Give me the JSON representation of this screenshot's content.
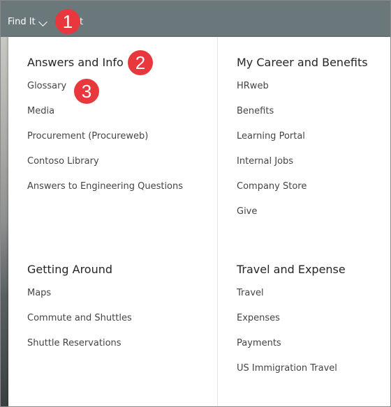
{
  "nav": {
    "items": [
      {
        "label": "Find It"
      },
      {
        "label": "t"
      }
    ]
  },
  "menu": {
    "sections": [
      {
        "heading": "Answers and Info",
        "links": [
          "Glossary",
          "Media",
          "Procurement (Procureweb)",
          "Contoso Library",
          "Answers to Engineering Questions"
        ]
      },
      {
        "heading": "My Career and Benefits",
        "links": [
          "HRweb",
          "Benefits",
          "Learning Portal",
          "Internal Jobs",
          "Company Store",
          "Give"
        ]
      },
      {
        "heading": "Getting Around",
        "links": [
          "Maps",
          "Commute and Shuttles",
          "Shuttle Reservations"
        ]
      },
      {
        "heading": "Travel and Expense",
        "links": [
          "Travel",
          "Expenses",
          "Payments",
          "US Immigration Travel"
        ]
      }
    ]
  },
  "callouts": [
    "1",
    "2",
    "3"
  ],
  "colors": {
    "topbar": "#6b787b",
    "callout": "#e8383d"
  }
}
